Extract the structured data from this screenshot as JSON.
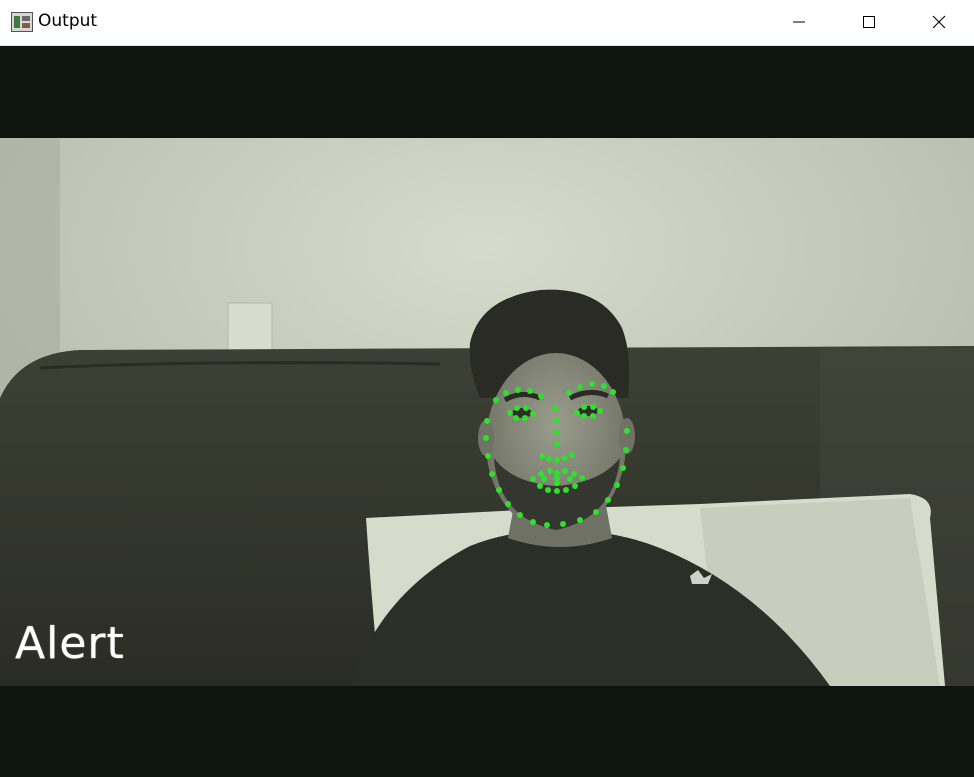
{
  "window": {
    "title": "Output",
    "icon": "app-window-icon",
    "controls": {
      "minimize": "minimize-icon",
      "maximize": "maximize-icon",
      "close": "close-icon"
    }
  },
  "frame": {
    "overlay_text": "Alert",
    "landmark_color": "#2fe02f",
    "overlay_text_color": "#ffffff",
    "letterbox_color": "#0e1510"
  }
}
